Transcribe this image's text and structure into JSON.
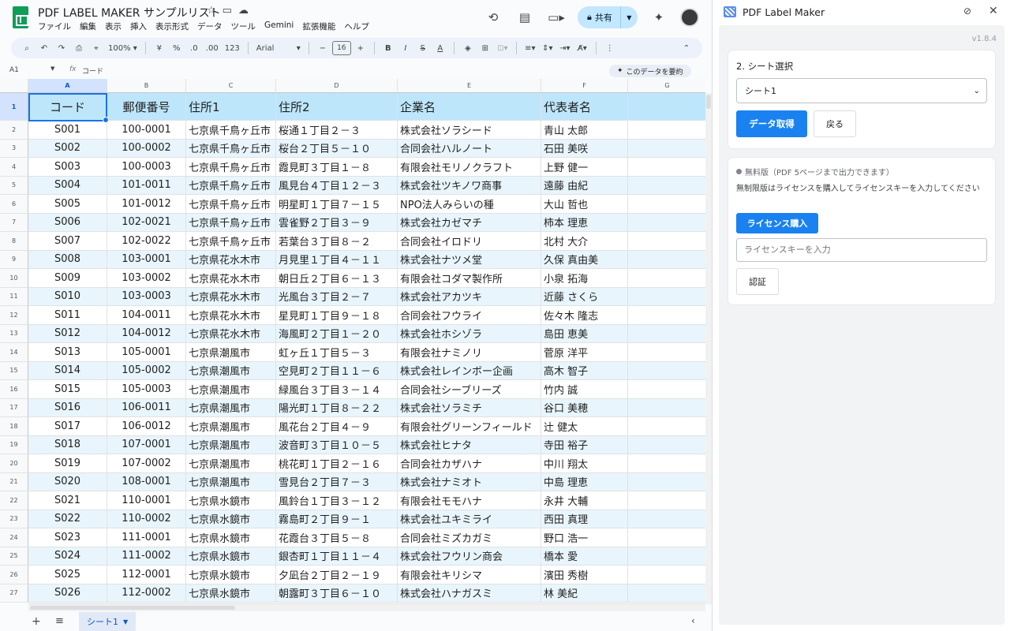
{
  "title_bar": {
    "doc_title": "PDF LABEL MAKER サンプルリスト",
    "menu": [
      "ファイル",
      "編集",
      "表示",
      "挿入",
      "表示形式",
      "データ",
      "ツール",
      "Gemini",
      "拡張機能",
      "ヘルプ"
    ],
    "share_label": "共有"
  },
  "toolbar": {
    "zoom": "100%",
    "currency": "¥",
    "percent": "%",
    "dec_decrease": ".0",
    "dec_increase": ".00",
    "number_format": "123",
    "font": "Arial",
    "font_size": "16"
  },
  "formula_bar": {
    "cell_ref": "A1",
    "fx": "fx",
    "value": "コード",
    "summarize_label": "このデータを要約"
  },
  "columns": [
    "A",
    "B",
    "C",
    "D",
    "E",
    "F",
    "G"
  ],
  "table": {
    "headers": [
      "コード",
      "郵便番号",
      "住所1",
      "住所2",
      "企業名",
      "代表者名",
      ""
    ],
    "rows": [
      [
        "S001",
        "100-0001",
        "七京県千鳥ヶ丘市",
        "桜通１丁目２－３",
        "株式会社ソラシード",
        "青山 太郎",
        ""
      ],
      [
        "S002",
        "100-0002",
        "七京県千鳥ヶ丘市",
        "桜台２丁目５－１０",
        "合同会社ハルノート",
        "石田 美咲",
        ""
      ],
      [
        "S003",
        "100-0003",
        "七京県千鳥ヶ丘市",
        "霞見町３丁目１－８",
        "有限会社モリノクラフト",
        "上野 健一",
        ""
      ],
      [
        "S004",
        "101-0011",
        "七京県千鳥ヶ丘市",
        "風見台４丁目１２－３",
        "株式会社ツキノワ商事",
        "遠藤 由紀",
        ""
      ],
      [
        "S005",
        "101-0012",
        "七京県千鳥ヶ丘市",
        "明星町１丁目７－１５",
        "NPO法人みらいの種",
        "大山 哲也",
        ""
      ],
      [
        "S006",
        "102-0021",
        "七京県千鳥ヶ丘市",
        "雲雀野２丁目３－９",
        "株式会社カゼマチ",
        "柿本 理恵",
        ""
      ],
      [
        "S007",
        "102-0022",
        "七京県千鳥ヶ丘市",
        "若葉台３丁目８－２",
        "合同会社イロドリ",
        "北村 大介",
        ""
      ],
      [
        "S008",
        "103-0001",
        "七京県花水木市",
        "月見里１丁目４－１１",
        "株式会社ナツメ堂",
        "久保 真由美",
        ""
      ],
      [
        "S009",
        "103-0002",
        "七京県花水木市",
        "朝日丘２丁目６－１３",
        "有限会社コダマ製作所",
        "小泉 拓海",
        ""
      ],
      [
        "S010",
        "103-0003",
        "七京県花水木市",
        "光風台３丁目２－７",
        "株式会社アカツキ",
        "近藤 さくら",
        ""
      ],
      [
        "S011",
        "104-0011",
        "七京県花水木市",
        "星見町１丁目９－１８",
        "合同会社フウライ",
        "佐々木 隆志",
        ""
      ],
      [
        "S012",
        "104-0012",
        "七京県花水木市",
        "海風町２丁目１－２０",
        "株式会社ホシゾラ",
        "島田 恵美",
        ""
      ],
      [
        "S013",
        "105-0001",
        "七京県潮風市",
        "虹ヶ丘１丁目５－３",
        "有限会社ナミノリ",
        "菅原 洋平",
        ""
      ],
      [
        "S014",
        "105-0002",
        "七京県潮風市",
        "空見町２丁目１１－６",
        "株式会社レインボー企画",
        "高木 智子",
        ""
      ],
      [
        "S015",
        "105-0003",
        "七京県潮風市",
        "緑風台３丁目３－１４",
        "合同会社シーブリーズ",
        "竹内 誠",
        ""
      ],
      [
        "S016",
        "106-0011",
        "七京県潮風市",
        "陽光町１丁目８－２２",
        "株式会社ソラミチ",
        "谷口 美穂",
        ""
      ],
      [
        "S017",
        "106-0012",
        "七京県潮風市",
        "風花台２丁目４－９",
        "有限会社グリーンフィールド",
        "辻 健太",
        ""
      ],
      [
        "S018",
        "107-0001",
        "七京県潮風市",
        "波音町３丁目１０－５",
        "株式会社ヒナタ",
        "寺田 裕子",
        ""
      ],
      [
        "S019",
        "107-0002",
        "七京県潮風市",
        "桃花町１丁目２－１６",
        "合同会社カザハナ",
        "中川 翔太",
        ""
      ],
      [
        "S020",
        "108-0001",
        "七京県潮風市",
        "雪見台２丁目７－３",
        "株式会社ナミオト",
        "中島 理恵",
        ""
      ],
      [
        "S021",
        "110-0001",
        "七京県水鏡市",
        "風鈴台１丁目３－１２",
        "有限会社モモハナ",
        "永井 大輔",
        ""
      ],
      [
        "S022",
        "110-0002",
        "七京県水鏡市",
        "霧島町２丁目９－１",
        "株式会社ユキミライ",
        "西田 真理",
        ""
      ],
      [
        "S023",
        "111-0001",
        "七京県水鏡市",
        "花霞台３丁目５－８",
        "合同会社ミズカガミ",
        "野口 浩一",
        ""
      ],
      [
        "S024",
        "111-0002",
        "七京県水鏡市",
        "銀杏町１丁目１１－４",
        "株式会社フウリン商会",
        "橋本 愛",
        ""
      ],
      [
        "S025",
        "112-0001",
        "七京県水鏡市",
        "夕凪台２丁目２－１９",
        "有限会社キリシマ",
        "濱田 秀樹",
        ""
      ],
      [
        "S026",
        "112-0002",
        "七京県水鏡市",
        "朝露町３丁目６－１０",
        "株式会社ハナガスミ",
        "林 美紀",
        ""
      ]
    ]
  },
  "sheet_tabs": {
    "active": "シート1"
  },
  "panel": {
    "title": "PDF Label Maker",
    "version": "v1.8.4",
    "sheet_select": {
      "title": "2. シート選択",
      "selected": "シート1",
      "fetch_label": "データ取得",
      "back_label": "戻る"
    },
    "license": {
      "status": "無料版（PDF 5ページまで出力できます）",
      "info": "無制限版はライセンスを購入してライセンスキーを入力してください",
      "buy_label": "ライセンス購入",
      "input_placeholder": "ライセンスキーを入力",
      "verify_label": "認証"
    }
  },
  "colors": {
    "header_row": "#bde6fb",
    "band_row": "#e8f5fc",
    "primary_button": "#1a82f0",
    "share_button": "#c2e7ff",
    "sheets_green": "#0f9d58"
  },
  "icons": [
    "sheets-logo-icon",
    "star-icon",
    "folder-icon",
    "cloud-icon",
    "history-icon",
    "comment-icon",
    "video-icon",
    "lock-icon",
    "gemini-icon",
    "avatar",
    "search-icon",
    "undo-icon",
    "redo-icon",
    "print-icon",
    "paint-format-icon",
    "pin-off-icon",
    "close-icon"
  ]
}
